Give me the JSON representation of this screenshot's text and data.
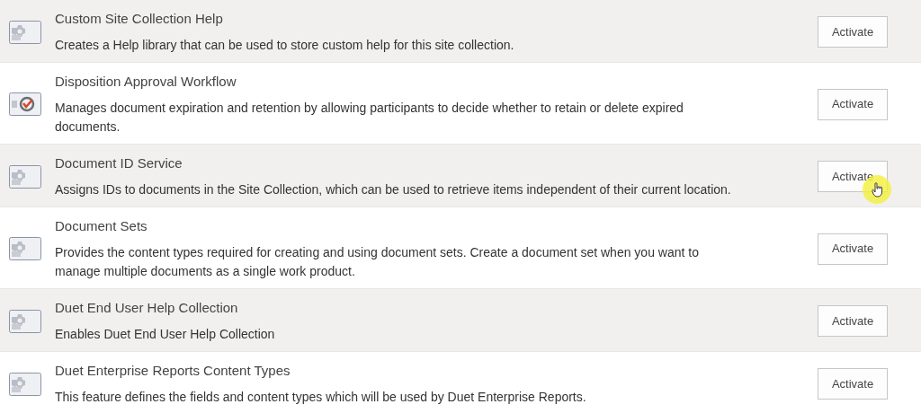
{
  "features": [
    {
      "kind": "gear",
      "title": "Custom Site Collection Help",
      "description": "Creates a Help library that can be used to store custom help for this site collection.",
      "button": "Activate",
      "pointer": false
    },
    {
      "kind": "approval",
      "title": "Disposition Approval Workflow",
      "description": "Manages document expiration and retention by allowing participants to decide whether to retain or delete expired documents.",
      "button": "Activate",
      "pointer": false
    },
    {
      "kind": "gear",
      "title": "Document ID Service",
      "description": "Assigns IDs to documents in the Site Collection, which can be used to retrieve items independent of their current location.",
      "button": "Activate",
      "pointer": true
    },
    {
      "kind": "gear",
      "title": "Document Sets",
      "description": "Provides the content types required for creating and using document sets. Create a document set when you want to manage multiple documents as a single work product.",
      "button": "Activate",
      "pointer": false
    },
    {
      "kind": "gear",
      "title": "Duet End User Help Collection",
      "description": "Enables Duet End User Help Collection",
      "button": "Activate",
      "pointer": false
    },
    {
      "kind": "gear",
      "title": "Duet Enterprise Reports Content Types",
      "description": "This feature defines the fields and content types which will be used by Duet Enterprise Reports.",
      "button": "Activate",
      "pointer": false
    }
  ]
}
